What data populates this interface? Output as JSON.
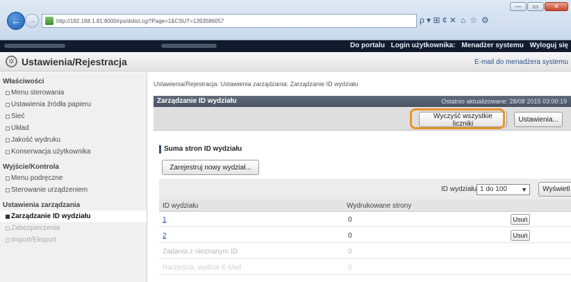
{
  "browser": {
    "url": "http://192.168.1.81:8000/rps/dslist.cgi?Page=1&CSUT=1393586057",
    "search_label": "ρ ▾ ⊞ ¢ ✕",
    "window_buttons": [
      "—",
      "▭",
      "✕"
    ]
  },
  "topbar": {
    "portal": "Do portalu",
    "login_user": "Login użytkownika:",
    "user_role": "Menadżer systemu",
    "logout": "Wyloguj się"
  },
  "header": {
    "title": "Ustawienia/Rejestracja",
    "mail_link": "E-mail do menadżera systemu"
  },
  "sidebar": {
    "groups": [
      {
        "title": "Właściwości",
        "items": [
          {
            "label": "Menu sterowania"
          },
          {
            "label": "Ustawienia źródła papieru"
          },
          {
            "label": "Sieć"
          },
          {
            "label": "Układ"
          },
          {
            "label": "Jakość wydruku"
          },
          {
            "label": "Konserwacja użytkownika"
          }
        ]
      },
      {
        "title": "Wyjście/Kontrola",
        "items": [
          {
            "label": "Menu podręczne"
          },
          {
            "label": "Sterowanie urządzeniem"
          }
        ]
      },
      {
        "title": "Ustawienia zarządzania",
        "items": [
          {
            "label": "Zarządzanie ID wydziału"
          },
          {
            "label": "Zabezpieczenia"
          },
          {
            "label": "Import/Eksport"
          }
        ]
      }
    ]
  },
  "main": {
    "breadcrumb": "Ustawienia/Rejestracja: Ustawienia zarządzania: Zarządzanie ID wydziału",
    "panel_title": "Zarządzanie ID wydziału",
    "last_updated": "Ostatnio aktualizowane: 28/08 2015 03:00:19",
    "clear_counters": "Wyczyść wszystkie liczniki",
    "settings_button": "Ustawienia...",
    "section_title": "Suma stron ID wydziału",
    "register_button": "Zarejestruj nowy wydział...",
    "filter_label": "ID wydziału:",
    "filter_value": "1 do 100",
    "show_button": "Wyświetl",
    "col_id": "ID wydziału",
    "col_pages": "Wydrukowane strony",
    "delete_label": "Usuń",
    "rows": [
      {
        "id": "1",
        "pages": "0"
      },
      {
        "id": "2",
        "pages": "0"
      },
      {
        "id": "Zadania z nieznanym ID",
        "pages": "0"
      },
      {
        "id": "Narzędzia, wydruk E-Mail",
        "pages": "0"
      }
    ]
  }
}
